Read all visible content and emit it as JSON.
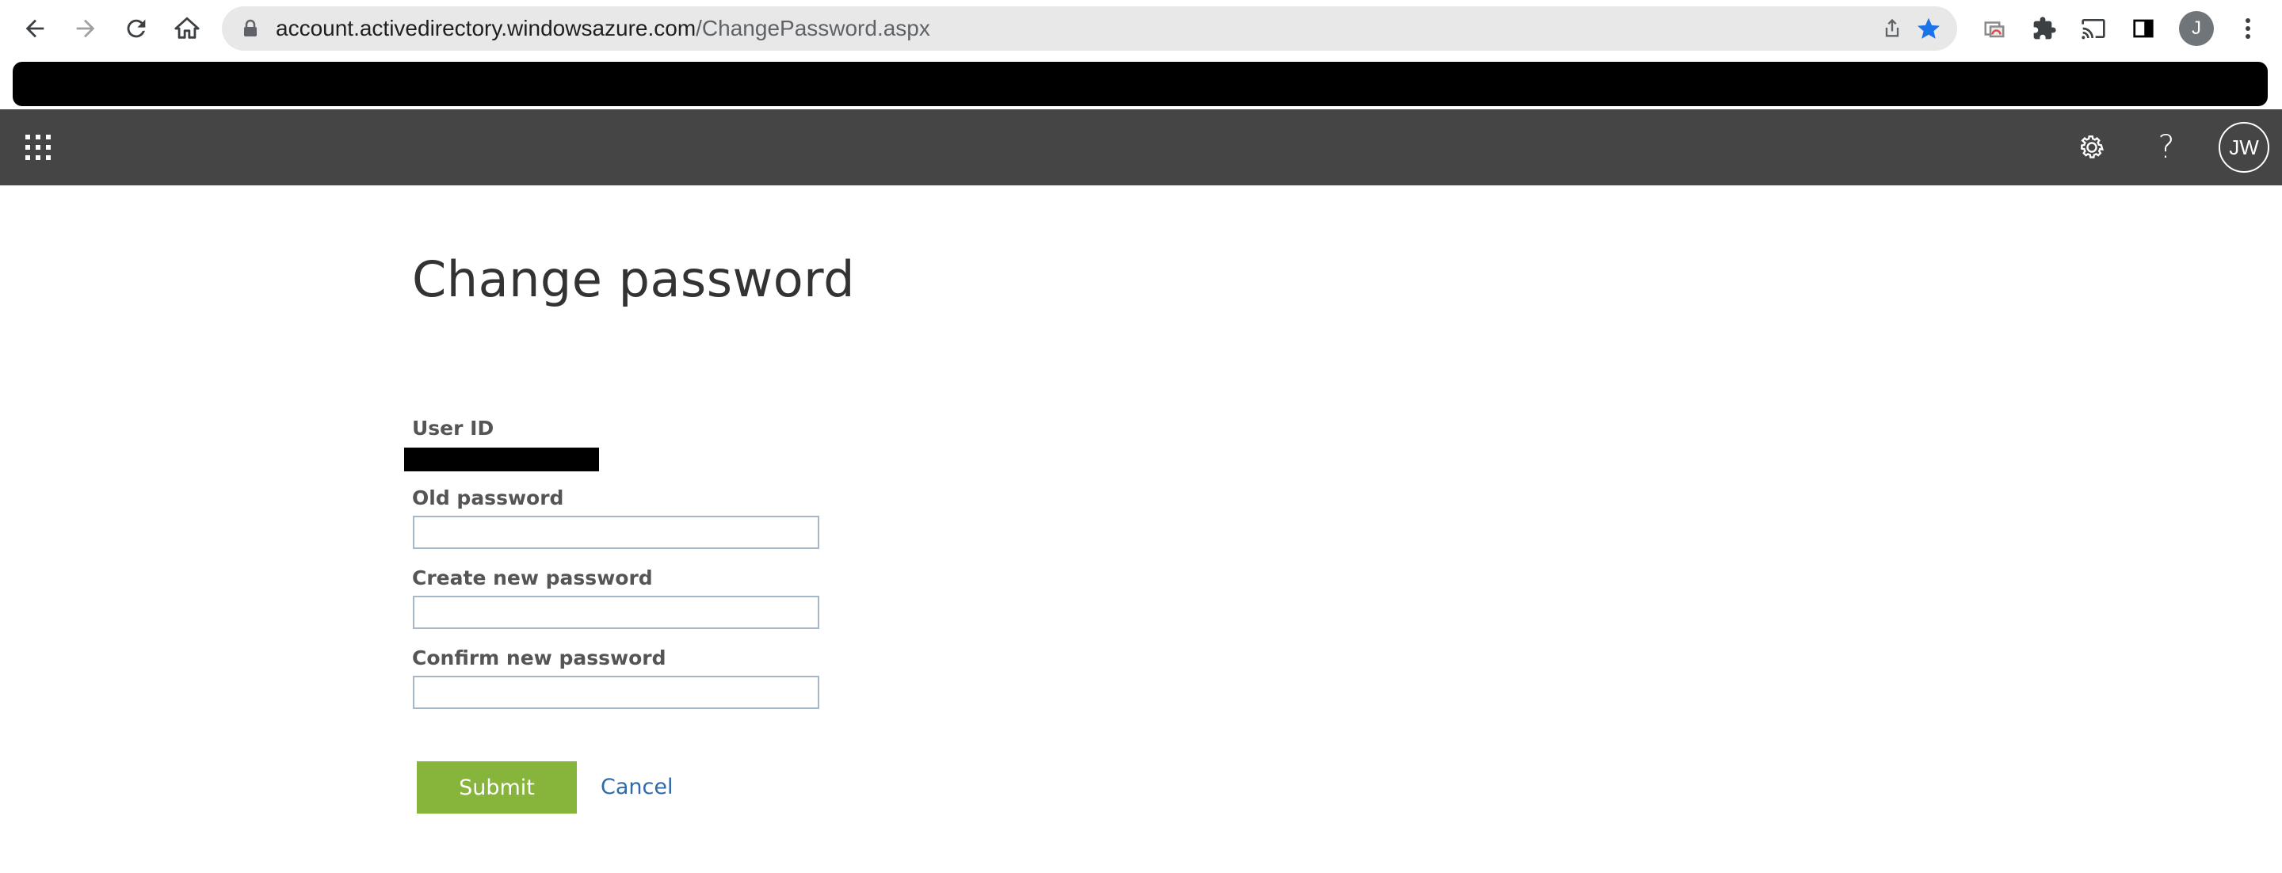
{
  "browser": {
    "url_host": "account.activedirectory.windowsazure.com",
    "url_path": "/ChangePassword.aspx",
    "profile_initial": "J"
  },
  "header": {
    "avatar_initials": "JW",
    "help_glyph": "?"
  },
  "page": {
    "title": "Change password",
    "user_id_label": "User ID",
    "old_password_label": "Old password",
    "new_password_label": "Create new password",
    "confirm_password_label": "Confirm new password",
    "old_password_value": "",
    "new_password_value": "",
    "confirm_password_value": "",
    "submit_label": "Submit",
    "cancel_label": "Cancel"
  },
  "colors": {
    "appbar": "#454545",
    "submit": "#87b43a",
    "link": "#2f6aa8",
    "bookmark_star": "#1a73e8"
  },
  "icons": [
    "back-icon",
    "forward-icon",
    "reload-icon",
    "home-icon",
    "lock-icon",
    "share-icon",
    "bookmark-star-icon",
    "extension-icon",
    "puzzle-icon",
    "cast-icon",
    "side-panel-icon",
    "kebab-menu-icon",
    "app-launcher-icon",
    "gear-icon",
    "help-icon"
  ]
}
